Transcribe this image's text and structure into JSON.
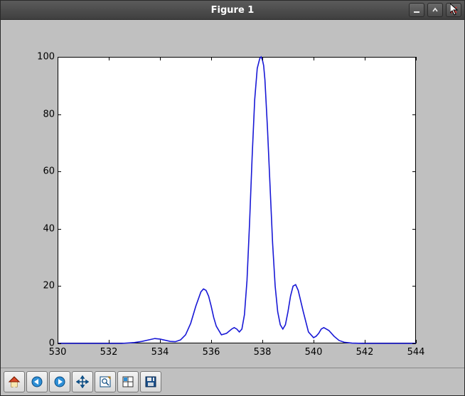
{
  "window": {
    "title": "Figure 1",
    "buttons": {
      "minimize": "minimize",
      "maximize": "maximize",
      "close": "close"
    }
  },
  "toolbar": {
    "items": [
      {
        "name": "home-icon",
        "label": "Home"
      },
      {
        "name": "back-icon",
        "label": "Back"
      },
      {
        "name": "forward-icon",
        "label": "Forward"
      },
      {
        "name": "pan-icon",
        "label": "Pan"
      },
      {
        "name": "zoom-icon",
        "label": "Zoom"
      },
      {
        "name": "subplots-icon",
        "label": "Configure subplots"
      },
      {
        "name": "save-icon",
        "label": "Save"
      }
    ]
  },
  "chart_data": {
    "type": "line",
    "title": "",
    "xlabel": "",
    "ylabel": "",
    "xlim": [
      530,
      544
    ],
    "ylim": [
      0,
      100
    ],
    "xticks": [
      530,
      532,
      534,
      536,
      538,
      540,
      542,
      544
    ],
    "yticks": [
      0,
      20,
      40,
      60,
      80,
      100
    ],
    "line_color": "#1818d6",
    "x": [
      530.0,
      530.5,
      531.0,
      531.5,
      532.0,
      532.5,
      533.0,
      533.3,
      533.6,
      533.8,
      534.0,
      534.2,
      534.4,
      534.6,
      534.8,
      535.0,
      535.2,
      535.4,
      535.6,
      535.7,
      535.8,
      535.9,
      536.0,
      536.1,
      536.2,
      536.4,
      536.6,
      536.8,
      536.9,
      537.0,
      537.1,
      537.2,
      537.3,
      537.4,
      537.5,
      537.6,
      537.7,
      537.8,
      537.9,
      537.95,
      538.0,
      538.05,
      538.1,
      538.2,
      538.3,
      538.4,
      538.5,
      538.6,
      538.7,
      538.8,
      538.9,
      539.0,
      539.1,
      539.2,
      539.3,
      539.4,
      539.6,
      539.8,
      540.0,
      540.1,
      540.2,
      540.3,
      540.4,
      540.6,
      540.8,
      541.0,
      541.2,
      541.5,
      542.0,
      542.5,
      543.0,
      543.5,
      544.0
    ],
    "values": [
      0.0,
      0.0,
      0.0,
      0.0,
      0.0,
      0.0,
      0.3,
      0.7,
      1.3,
      1.7,
      1.5,
      1.1,
      0.7,
      0.6,
      1.2,
      3.0,
      7.0,
      13.0,
      18.0,
      19.0,
      18.5,
      16.5,
      13.0,
      9.0,
      6.0,
      3.0,
      3.5,
      5.0,
      5.5,
      5.0,
      4.0,
      5.0,
      10.0,
      22.0,
      42.0,
      65.0,
      85.0,
      96.0,
      99.5,
      100.0,
      99.0,
      97.0,
      92.0,
      75.0,
      55.0,
      35.0,
      20.0,
      11.0,
      6.5,
      5.0,
      6.5,
      11.0,
      16.5,
      20.0,
      20.5,
      18.5,
      11.0,
      4.0,
      2.0,
      2.5,
      3.5,
      5.0,
      5.5,
      4.5,
      2.5,
      1.0,
      0.4,
      0.1,
      0.0,
      0.0,
      0.0,
      0.0,
      0.0
    ]
  }
}
